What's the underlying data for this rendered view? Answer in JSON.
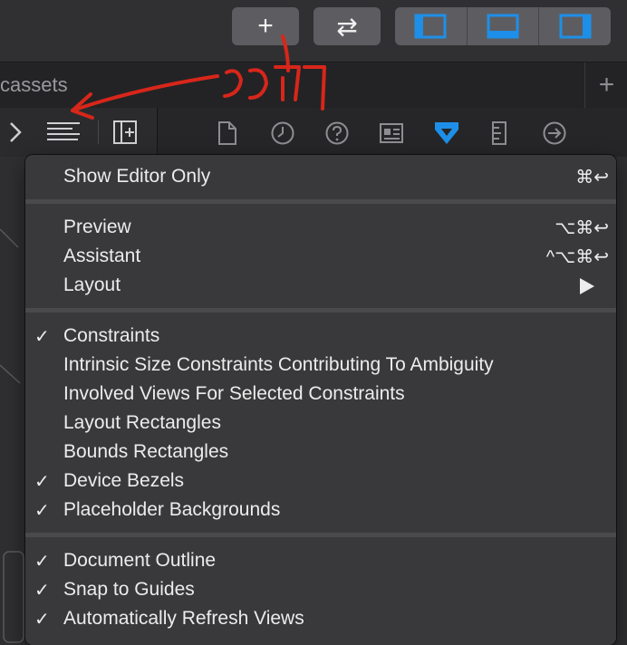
{
  "toolbar": {
    "add_symbol": "+",
    "swap_symbol": "⇄",
    "accent_color": "#1e8fe8"
  },
  "tab": {
    "label": "cassets",
    "add_symbol": "+"
  },
  "menu": {
    "groups": [
      [
        {
          "label": "Show Editor Only",
          "shortcut": "⌘↩",
          "checked": false
        }
      ],
      [
        {
          "label": "Preview",
          "shortcut": "⌥⌘↩",
          "checked": false
        },
        {
          "label": "Assistant",
          "shortcut": "^⌥⌘↩",
          "checked": false
        },
        {
          "label": "Layout",
          "submenu": true,
          "checked": false
        }
      ],
      [
        {
          "label": "Constraints",
          "checked": true
        },
        {
          "label": "Intrinsic Size Constraints Contributing To Ambiguity",
          "checked": false
        },
        {
          "label": "Involved Views For Selected Constraints",
          "checked": false
        },
        {
          "label": "Layout Rectangles",
          "checked": false
        },
        {
          "label": "Bounds Rectangles",
          "checked": false
        },
        {
          "label": "Device Bezels",
          "checked": true
        },
        {
          "label": "Placeholder Backgrounds",
          "checked": true
        }
      ],
      [
        {
          "label": "Document Outline",
          "checked": true
        },
        {
          "label": "Snap to Guides",
          "checked": true
        },
        {
          "label": "Automatically Refresh Views",
          "checked": true
        }
      ]
    ],
    "check_symbol": "✓"
  },
  "annotation": {
    "color": "#d8261a"
  }
}
